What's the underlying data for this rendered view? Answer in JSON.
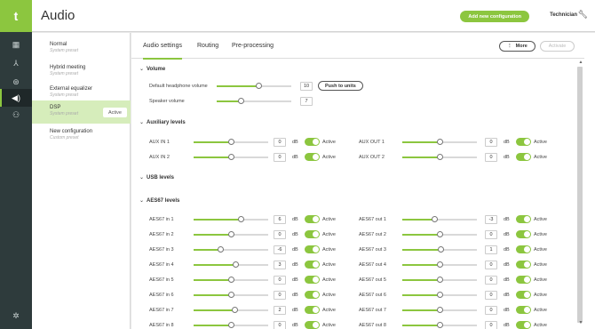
{
  "app": {
    "logo": "t",
    "title": "Audio",
    "add_config_label": "Add new configuration",
    "user_label": "Technician"
  },
  "rail": [
    "dashboard-icon",
    "network-icon",
    "broadcast-icon",
    "audio-icon",
    "users-icon",
    "gear-icon"
  ],
  "presets": [
    {
      "name": "Normal",
      "sub": "System preset"
    },
    {
      "name": "Hybrid meeting",
      "sub": "System preset"
    },
    {
      "name": "External equalizer",
      "sub": "System preset"
    },
    {
      "name": "DSP",
      "sub": "System preset",
      "badge": "Active"
    },
    {
      "name": "New configuration",
      "sub": "Custom preset"
    }
  ],
  "tabs": [
    "Audio settings",
    "Routing",
    "Pre-processing"
  ],
  "toolbar": {
    "more_label": "More",
    "activate_label": "Activate"
  },
  "colors": {
    "accent": "#8cc63f",
    "rail": "#2e3b3c"
  },
  "volume": {
    "heading": "Volume",
    "headphone": {
      "label": "Default headphone volume",
      "value": "10",
      "level": 0.57,
      "push_label": "Push to units"
    },
    "speaker": {
      "label": "Speaker volume",
      "value": "7",
      "level": 0.33
    }
  },
  "aux": {
    "heading": "Auxiliary levels",
    "unit": "dB",
    "toggle_label": "Active",
    "left": [
      {
        "label": "AUX IN 1",
        "value": "0",
        "level": 0.5
      },
      {
        "label": "AUX IN 2",
        "value": "0",
        "level": 0.5
      }
    ],
    "right": [
      {
        "label": "AUX OUT 1",
        "value": "0",
        "level": 0.5
      },
      {
        "label": "AUX OUT 2",
        "value": "0",
        "level": 0.5
      }
    ]
  },
  "usb": {
    "heading": "USB levels"
  },
  "aes": {
    "heading": "AES67 levels",
    "unit": "dB",
    "toggle_label": "Active",
    "left": [
      {
        "label": "AES67 in 1",
        "value": "6",
        "level": 0.64
      },
      {
        "label": "AES67 in 2",
        "value": "0",
        "level": 0.5
      },
      {
        "label": "AES67 in 3",
        "value": "-6",
        "level": 0.36
      },
      {
        "label": "AES67 in 4",
        "value": "3",
        "level": 0.57
      },
      {
        "label": "AES67 in 5",
        "value": "0",
        "level": 0.5
      },
      {
        "label": "AES67 in 6",
        "value": "0",
        "level": 0.5
      },
      {
        "label": "AES67 in 7",
        "value": "2",
        "level": 0.55
      },
      {
        "label": "AES67 in 8",
        "value": "0",
        "level": 0.5
      }
    ],
    "right": [
      {
        "label": "AES67 out 1",
        "value": "-3",
        "level": 0.43
      },
      {
        "label": "AES67 out 2",
        "value": "0",
        "level": 0.5
      },
      {
        "label": "AES67 out 3",
        "value": "1",
        "level": 0.52
      },
      {
        "label": "AES67 out 4",
        "value": "0",
        "level": 0.5
      },
      {
        "label": "AES67 out 5",
        "value": "0",
        "level": 0.5
      },
      {
        "label": "AES67 out 6",
        "value": "0",
        "level": 0.5
      },
      {
        "label": "AES67 out 7",
        "value": "0",
        "level": 0.5
      },
      {
        "label": "AES67 out 8",
        "value": "0",
        "level": 0.5
      }
    ]
  }
}
